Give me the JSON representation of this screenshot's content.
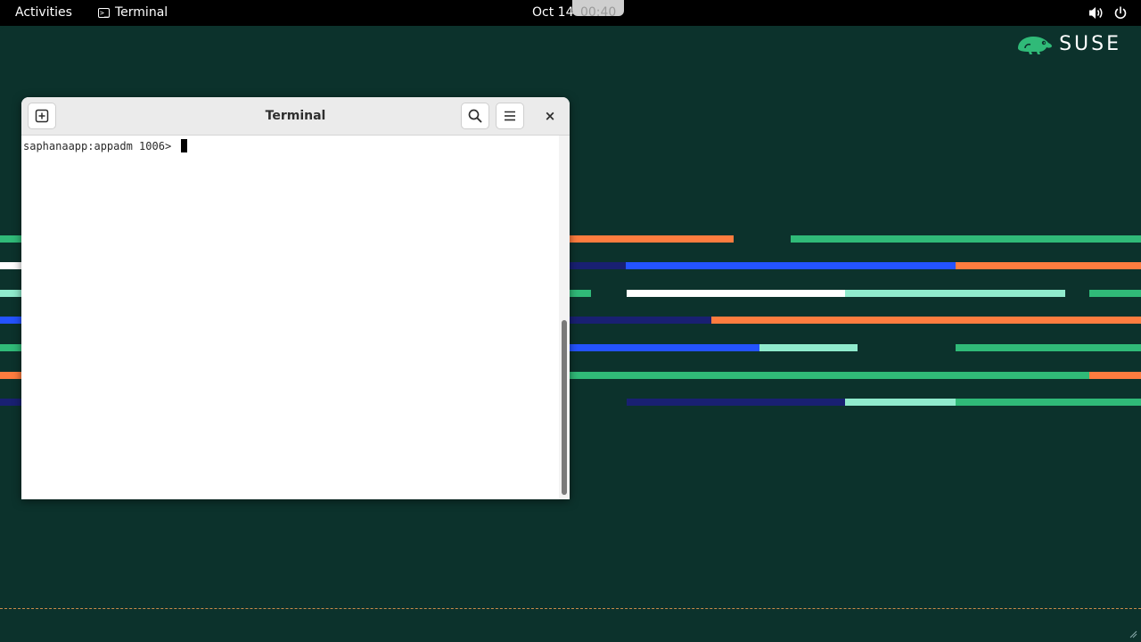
{
  "topbar": {
    "activities_label": "Activities",
    "app_name": "Terminal",
    "app_icon_glyph": ">_",
    "clock_date": "Oct 14",
    "clock_time": "00:40",
    "volume_icon": "speaker-icon",
    "power_icon": "power-icon"
  },
  "desktop": {
    "logo_text": "SUSE",
    "colors": {
      "background": "#0c322c",
      "green": "#30ba78",
      "orange": "#fe7c3f",
      "blue": "#2453ff",
      "navy": "#192072",
      "mint": "#90ebcd",
      "white": "#ffffff"
    }
  },
  "terminal": {
    "title": "Terminal",
    "new_tab_icon": "new-tab-icon",
    "search_icon": "search-icon",
    "menu_icon": "hamburger-menu-icon",
    "close_glyph": "×",
    "prompt": "saphanaapp:appadm 1006> "
  }
}
